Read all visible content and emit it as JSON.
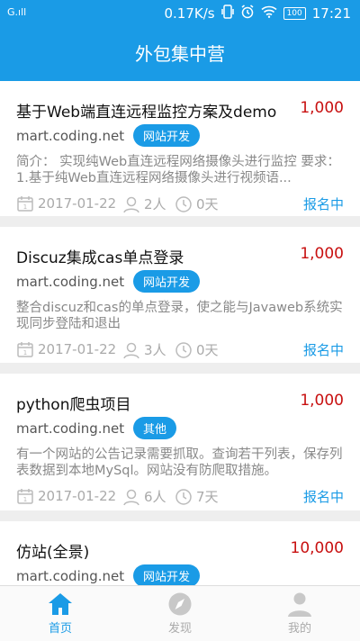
{
  "status_bar": {
    "signal": "G.ıll",
    "speed": "0.17K/s",
    "battery": "100",
    "time": "17:21"
  },
  "header": {
    "title": "外包集中营"
  },
  "projects": [
    {
      "title": "基于Web端直连远程监控方案及demo",
      "price": "1,000",
      "site": "mart.coding.net",
      "tag": "网站开发",
      "desc": "简介： 实现纯Web直连远程网络摄像头进行监控 要求： 1.基于纯Web直连远程网络摄像头进行视频语...",
      "date": "2017-01-22",
      "people": "2人",
      "days": "0天",
      "status": "报名中"
    },
    {
      "title": "Discuz集成cas单点登录",
      "price": "1,000",
      "site": "mart.coding.net",
      "tag": "网站开发",
      "desc": "整合discuz和cas的单点登录，使之能与Javaweb系统实现同步登陆和退出",
      "date": "2017-01-22",
      "people": "3人",
      "days": "0天",
      "status": "报名中"
    },
    {
      "title": "python爬虫项目",
      "price": "1,000",
      "site": "mart.coding.net",
      "tag": "其他",
      "desc": "有一个网站的公告记录需要抓取。查询若干列表，保存列表数据到本地MySql。网站没有防爬取措施。",
      "date": "2017-01-22",
      "people": "6人",
      "days": "7天",
      "status": "报名中"
    },
    {
      "title": "仿站(全景)",
      "price": "10,000",
      "site": "mart.coding.net",
      "tag": "网站开发"
    }
  ],
  "tabs": [
    {
      "label": "首页",
      "icon": "home-icon",
      "active": true
    },
    {
      "label": "发现",
      "icon": "compass-icon",
      "active": false
    },
    {
      "label": "我的",
      "icon": "user-icon",
      "active": false
    }
  ]
}
